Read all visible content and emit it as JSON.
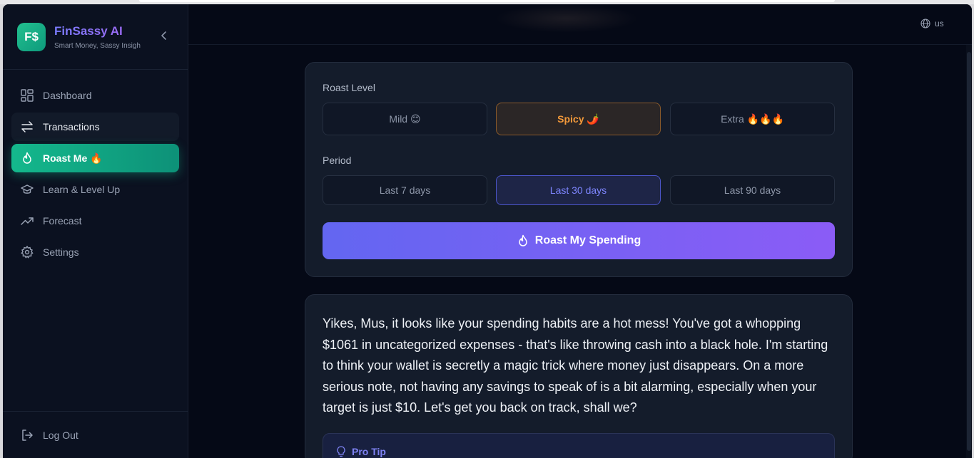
{
  "app": {
    "logo_text": "F$",
    "name": "FinSassy AI",
    "tagline": "Smart Money, Sassy Insigh"
  },
  "sidebar": {
    "items": [
      {
        "label": "Dashboard",
        "icon": "dashboard-icon"
      },
      {
        "label": "Transactions",
        "icon": "arrows-swap-icon"
      },
      {
        "label": "Roast Me 🔥",
        "icon": "flame-icon"
      },
      {
        "label": "Learn & Level Up",
        "icon": "graduation-cap-icon"
      },
      {
        "label": "Forecast",
        "icon": "trending-up-icon"
      },
      {
        "label": "Settings",
        "icon": "gear-icon"
      }
    ],
    "logout_label": "Log Out"
  },
  "topbar": {
    "language": "us"
  },
  "roast": {
    "level_label": "Roast Level",
    "levels": [
      "Mild 😊",
      "Spicy 🌶️",
      "Extra 🔥🔥🔥"
    ],
    "selected_level": "Spicy 🌶️",
    "period_label": "Period",
    "periods": [
      "Last 7 days",
      "Last 30 days",
      "Last 90 days"
    ],
    "selected_period": "Last 30 days",
    "button_label": "Roast My Spending"
  },
  "result": {
    "text": "Yikes, Mus, it looks like your spending habits are a hot mess! You've got a whopping $1061 in uncategorized expenses - that's like throwing cash into a black hole. I'm starting to think your wallet is secretly a magic trick where money just disappears. On a more serious note, not having any savings to speak of is a bit alarming, especially when your target is just $10. Let's get you back on track, shall we?",
    "tip_title": "Pro Tip"
  },
  "colors": {
    "accent_green": "#14b88c",
    "accent_purple": "#6366f1",
    "spicy_orange": "#f59a3a",
    "background": "#050916"
  }
}
